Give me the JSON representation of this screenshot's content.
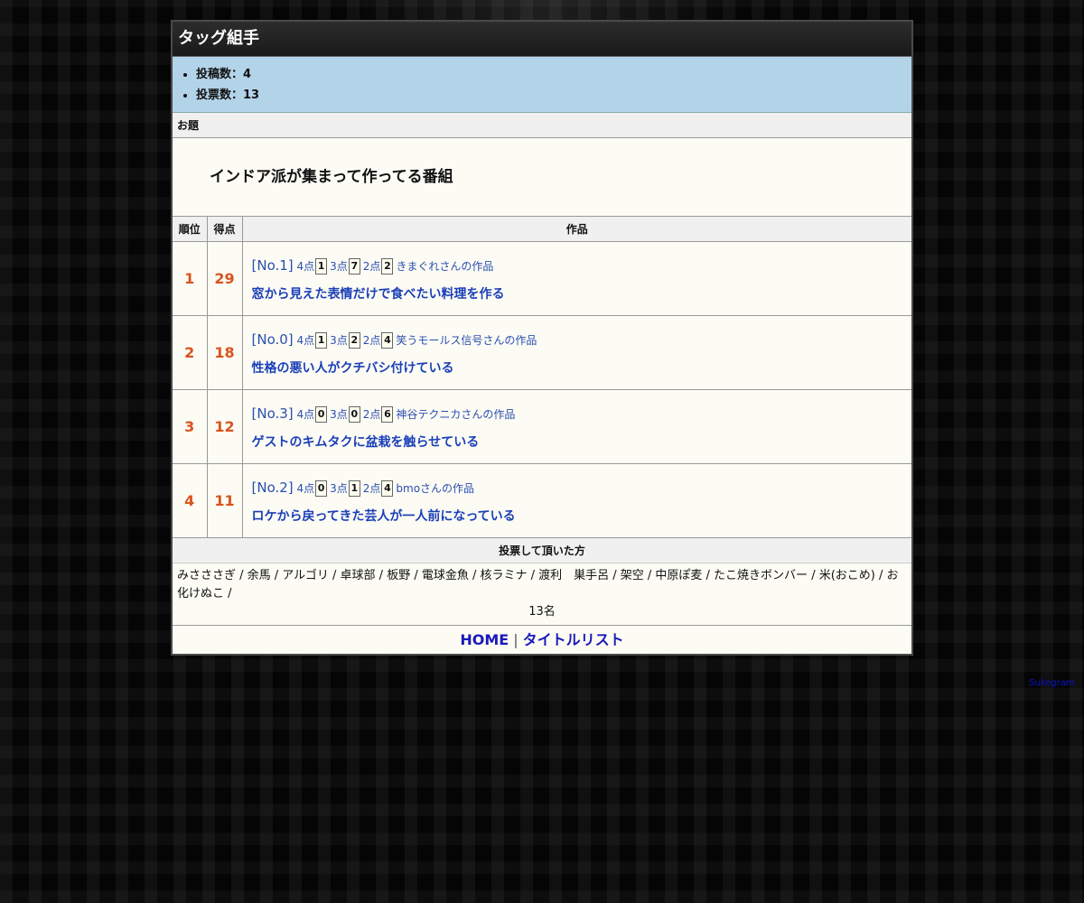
{
  "page": {
    "title": "タッグ組手"
  },
  "stats": [
    "投稿数：4",
    "投票数：13"
  ],
  "odai": {
    "heading": "お題",
    "text": "インドア派が集まって作ってる番組"
  },
  "table": {
    "headers": {
      "rank": "順位",
      "score": "得点",
      "work": "作品"
    },
    "rows": [
      {
        "rank": "1",
        "score": "29",
        "no": "[No.1]",
        "p4_label": "4点",
        "p4": "1",
        "p3_label": "3点",
        "p3": "7",
        "p2_label": "2点",
        "p2": "2",
        "author": "きまぐれさんの作品",
        "title": "窓から見えた表情だけで食べたい料理を作る"
      },
      {
        "rank": "2",
        "score": "18",
        "no": "[No.0]",
        "p4_label": "4点",
        "p4": "1",
        "p3_label": "3点",
        "p3": "2",
        "p2_label": "2点",
        "p2": "4",
        "author": "笑うモールス信号さんの作品",
        "title": "性格の悪い人がクチバシ付けている"
      },
      {
        "rank": "3",
        "score": "12",
        "no": "[No.3]",
        "p4_label": "4点",
        "p4": "0",
        "p3_label": "3点",
        "p3": "0",
        "p2_label": "2点",
        "p2": "6",
        "author": "神谷テクニカさんの作品",
        "title": "ゲストのキムタクに盆栽を触らせている"
      },
      {
        "rank": "4",
        "score": "11",
        "no": "[No.2]",
        "p4_label": "4点",
        "p4": "0",
        "p3_label": "3点",
        "p3": "1",
        "p2_label": "2点",
        "p2": "4",
        "author": "bmoさんの作品",
        "title": "ロケから戻ってきた芸人が一人前になっている"
      }
    ]
  },
  "voters": {
    "heading": "投票して頂いた方",
    "list": "みさささぎ / 余馬 / アルゴリ / 卓球部 / 板野 / 電球金魚 / 核ラミナ / 渡利　巣手呂 / 架空 / 中原ぽ麦 / たこ焼きボンバー / 米(おこめ) / お化けぬこ /",
    "count": "13名"
  },
  "nav": {
    "home": "HOME",
    "separator": "|",
    "title_list": "タイトルリスト"
  },
  "credit": {
    "label": "Sukegram"
  }
}
